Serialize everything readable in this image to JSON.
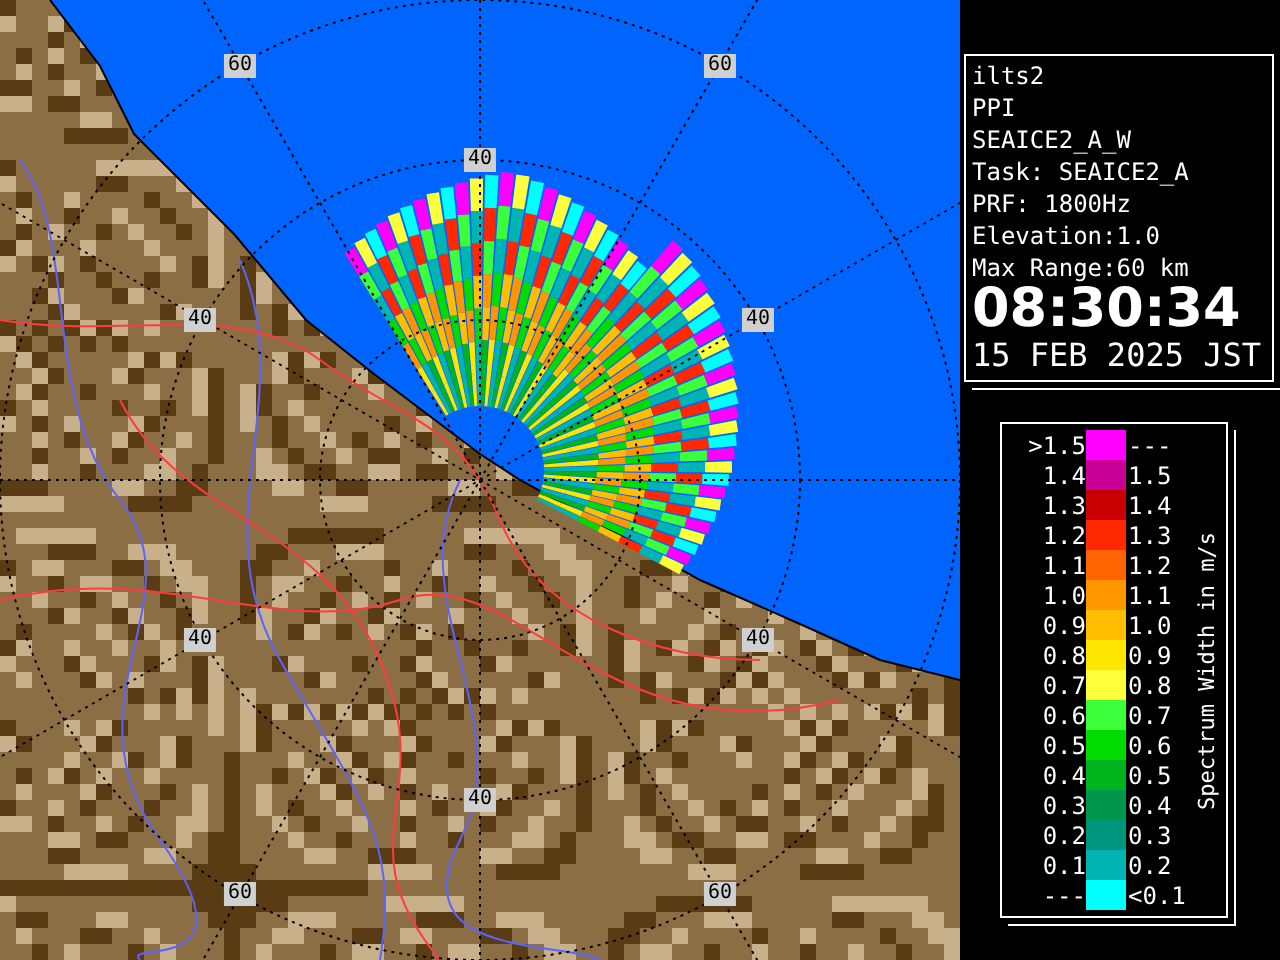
{
  "map": {
    "range_labels": [
      "60",
      "60",
      "40",
      "40",
      "40",
      "40",
      "40",
      "40",
      "60",
      "60"
    ]
  },
  "info": {
    "lines": [
      "ilts2",
      "PPI",
      "SEAICE2_A_W",
      "Task: SEAICE2_A",
      "PRF: 1800Hz",
      "Elevation:1.0",
      "Max Range:60 km"
    ],
    "time": "08:30:34",
    "date": "15 FEB 2025 JST"
  },
  "legend": {
    "title": "Spectrum Width in m/s",
    "rows": [
      {
        "low": ">1.5",
        "high": "---",
        "color": "#ff00ff"
      },
      {
        "low": "1.4",
        "high": "1.5",
        "color": "#c80096"
      },
      {
        "low": "1.3",
        "high": "1.4",
        "color": "#c80000"
      },
      {
        "low": "1.2",
        "high": "1.3",
        "color": "#ff2800"
      },
      {
        "low": "1.1",
        "high": "1.2",
        "color": "#ff6400"
      },
      {
        "low": "1.0",
        "high": "1.1",
        "color": "#ff9600"
      },
      {
        "low": "0.9",
        "high": "1.0",
        "color": "#ffbe00"
      },
      {
        "low": "0.8",
        "high": "0.9",
        "color": "#ffe600"
      },
      {
        "low": "0.7",
        "high": "0.8",
        "color": "#ffff3c"
      },
      {
        "low": "0.6",
        "high": "0.7",
        "color": "#3cff3c"
      },
      {
        "low": "0.5",
        "high": "0.6",
        "color": "#00dc00"
      },
      {
        "low": "0.4",
        "high": "0.5",
        "color": "#00b41e"
      },
      {
        "low": "0.3",
        "high": "0.4",
        "color": "#00964b"
      },
      {
        "low": "0.2",
        "high": "0.3",
        "color": "#00967d"
      },
      {
        "low": "0.1",
        "high": "0.2",
        "color": "#00b4b4"
      },
      {
        "low": "---",
        "high": "<0.1",
        "color": "#00ffff"
      }
    ]
  }
}
